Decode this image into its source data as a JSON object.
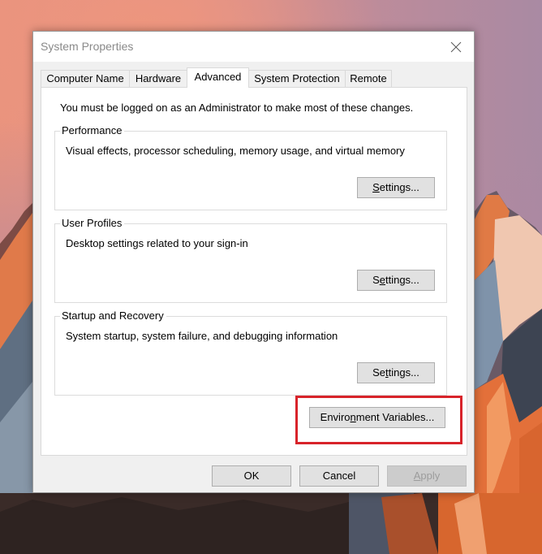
{
  "window": {
    "title": "System Properties",
    "close_icon": "close-x-icon"
  },
  "tabs": [
    {
      "label": "Computer Name",
      "active": false
    },
    {
      "label": "Hardware",
      "active": false
    },
    {
      "label": "Advanced",
      "active": true
    },
    {
      "label": "System Protection",
      "active": false
    },
    {
      "label": "Remote",
      "active": false
    }
  ],
  "advanced": {
    "admin_note": "You must be logged on as an Administrator to make most of these changes.",
    "groups": [
      {
        "title": "Performance",
        "description": "Visual effects, processor scheduling, memory usage, and virtual memory",
        "button": {
          "before": "",
          "accel": "S",
          "after": "ettings..."
        }
      },
      {
        "title": "User Profiles",
        "description": "Desktop settings related to your sign-in",
        "button": {
          "before": "S",
          "accel": "e",
          "after": "ttings..."
        }
      },
      {
        "title": "Startup and Recovery",
        "description": "System startup, system failure, and debugging information",
        "button": {
          "before": "Se",
          "accel": "t",
          "after": "tings..."
        }
      }
    ],
    "env_button": {
      "before": "Enviro",
      "accel": "n",
      "after": "ment Variables..."
    },
    "highlight_color": "#d8232a"
  },
  "footer": {
    "ok": "OK",
    "cancel": "Cancel",
    "apply": {
      "before": "",
      "accel": "A",
      "after": "pply",
      "disabled": true
    }
  }
}
